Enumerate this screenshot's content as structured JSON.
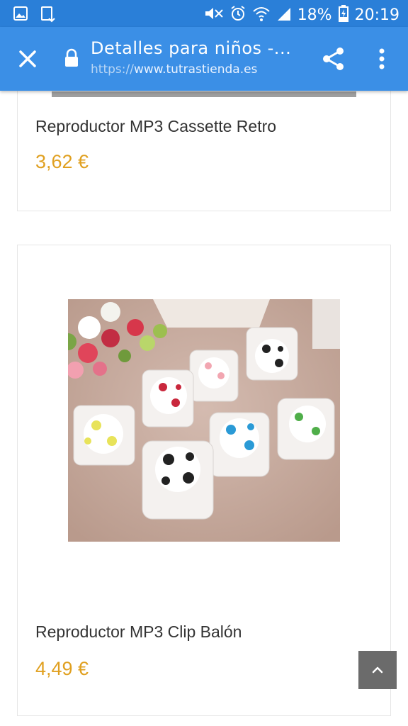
{
  "status_bar": {
    "battery_percent": "18%",
    "time": "20:19",
    "icons": [
      "gallery-icon",
      "download-icon",
      "mute-icon",
      "alarm-icon",
      "wifi-icon",
      "signal-icon",
      "battery-charging-icon"
    ]
  },
  "browser": {
    "title": "Detalles para niños -...",
    "url_scheme": "https://",
    "url_host": "www.tutrastienda.es",
    "icons": [
      "close-icon",
      "lock-icon",
      "share-icon",
      "more-vert-icon"
    ]
  },
  "products": [
    {
      "name": "Reproductor MP3 Cassette Retro",
      "price": "3,62 €"
    },
    {
      "name": "Reproductor MP3 Clip Balón",
      "price": "4,49 €"
    }
  ],
  "scroll_top_icon": "chevron-up-icon",
  "colors": {
    "status_bar": "#2a7fd8",
    "app_bar": "#3b8fe6",
    "price": "#e0a020",
    "scroll_top_button": "#6b6b6b"
  }
}
